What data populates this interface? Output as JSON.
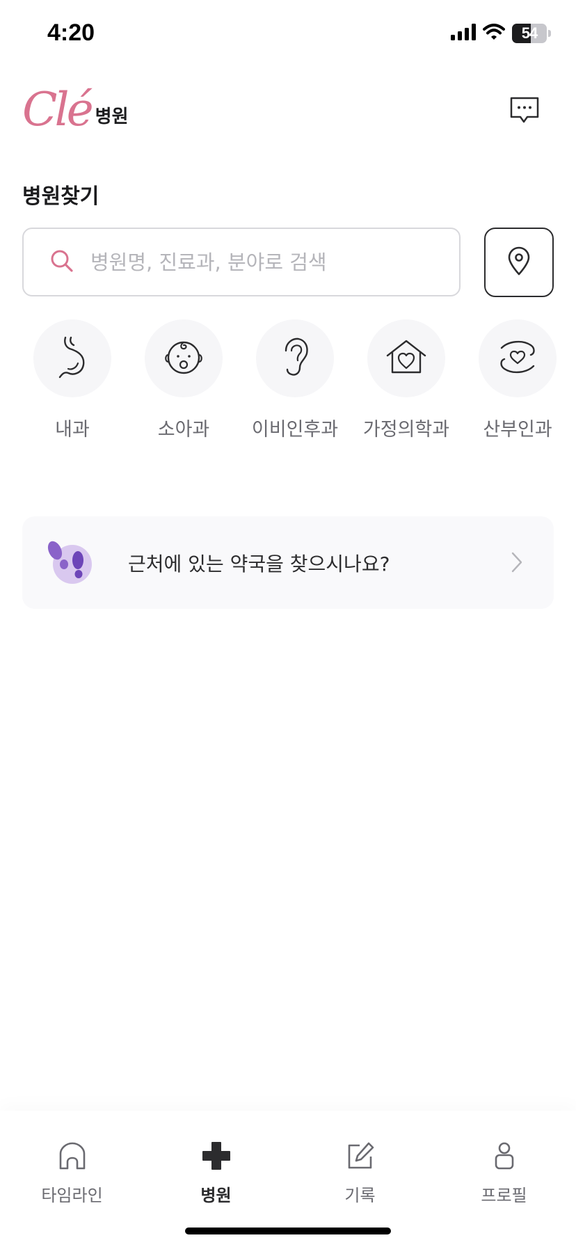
{
  "status_bar": {
    "time": "4:20",
    "battery_percent": 54,
    "battery_label": "54",
    "icons": [
      "cellular-signal-icon",
      "wifi-icon",
      "battery-icon"
    ]
  },
  "header": {
    "logo_text": "Clé",
    "logo_suffix": "병원",
    "logo_color": "#d9738f",
    "chat_icon": "chat-bubble-icon"
  },
  "section_title": "병원찾기",
  "search": {
    "placeholder": "병원명, 진료과, 분야로 검색",
    "value": "",
    "icon": "search-icon",
    "icon_color": "#d9738f",
    "location_icon": "map-pin-icon"
  },
  "categories": [
    {
      "label": "내과",
      "icon": "stomach-icon"
    },
    {
      "label": "소아과",
      "icon": "baby-icon"
    },
    {
      "label": "이비인후과",
      "icon": "ear-icon"
    },
    {
      "label": "가정의학과",
      "icon": "house-heart-icon"
    },
    {
      "label": "산부인과",
      "icon": "hands-heart-icon"
    }
  ],
  "pharmacy_banner": {
    "text": "근처에 있는 약국을 찾으시나요?",
    "icon": "footprints-icon",
    "accent_color": "#8a63c9",
    "arrow_icon": "chevron-right-icon"
  },
  "tab_bar": {
    "active_tab": "병원",
    "tabs": [
      {
        "label": "타임라인",
        "icon": "home-icon",
        "active": false
      },
      {
        "label": "병원",
        "icon": "medical-cross-icon",
        "active": true
      },
      {
        "label": "기록",
        "icon": "edit-note-icon",
        "active": false
      },
      {
        "label": "프로필",
        "icon": "profile-icon",
        "active": false
      }
    ]
  }
}
